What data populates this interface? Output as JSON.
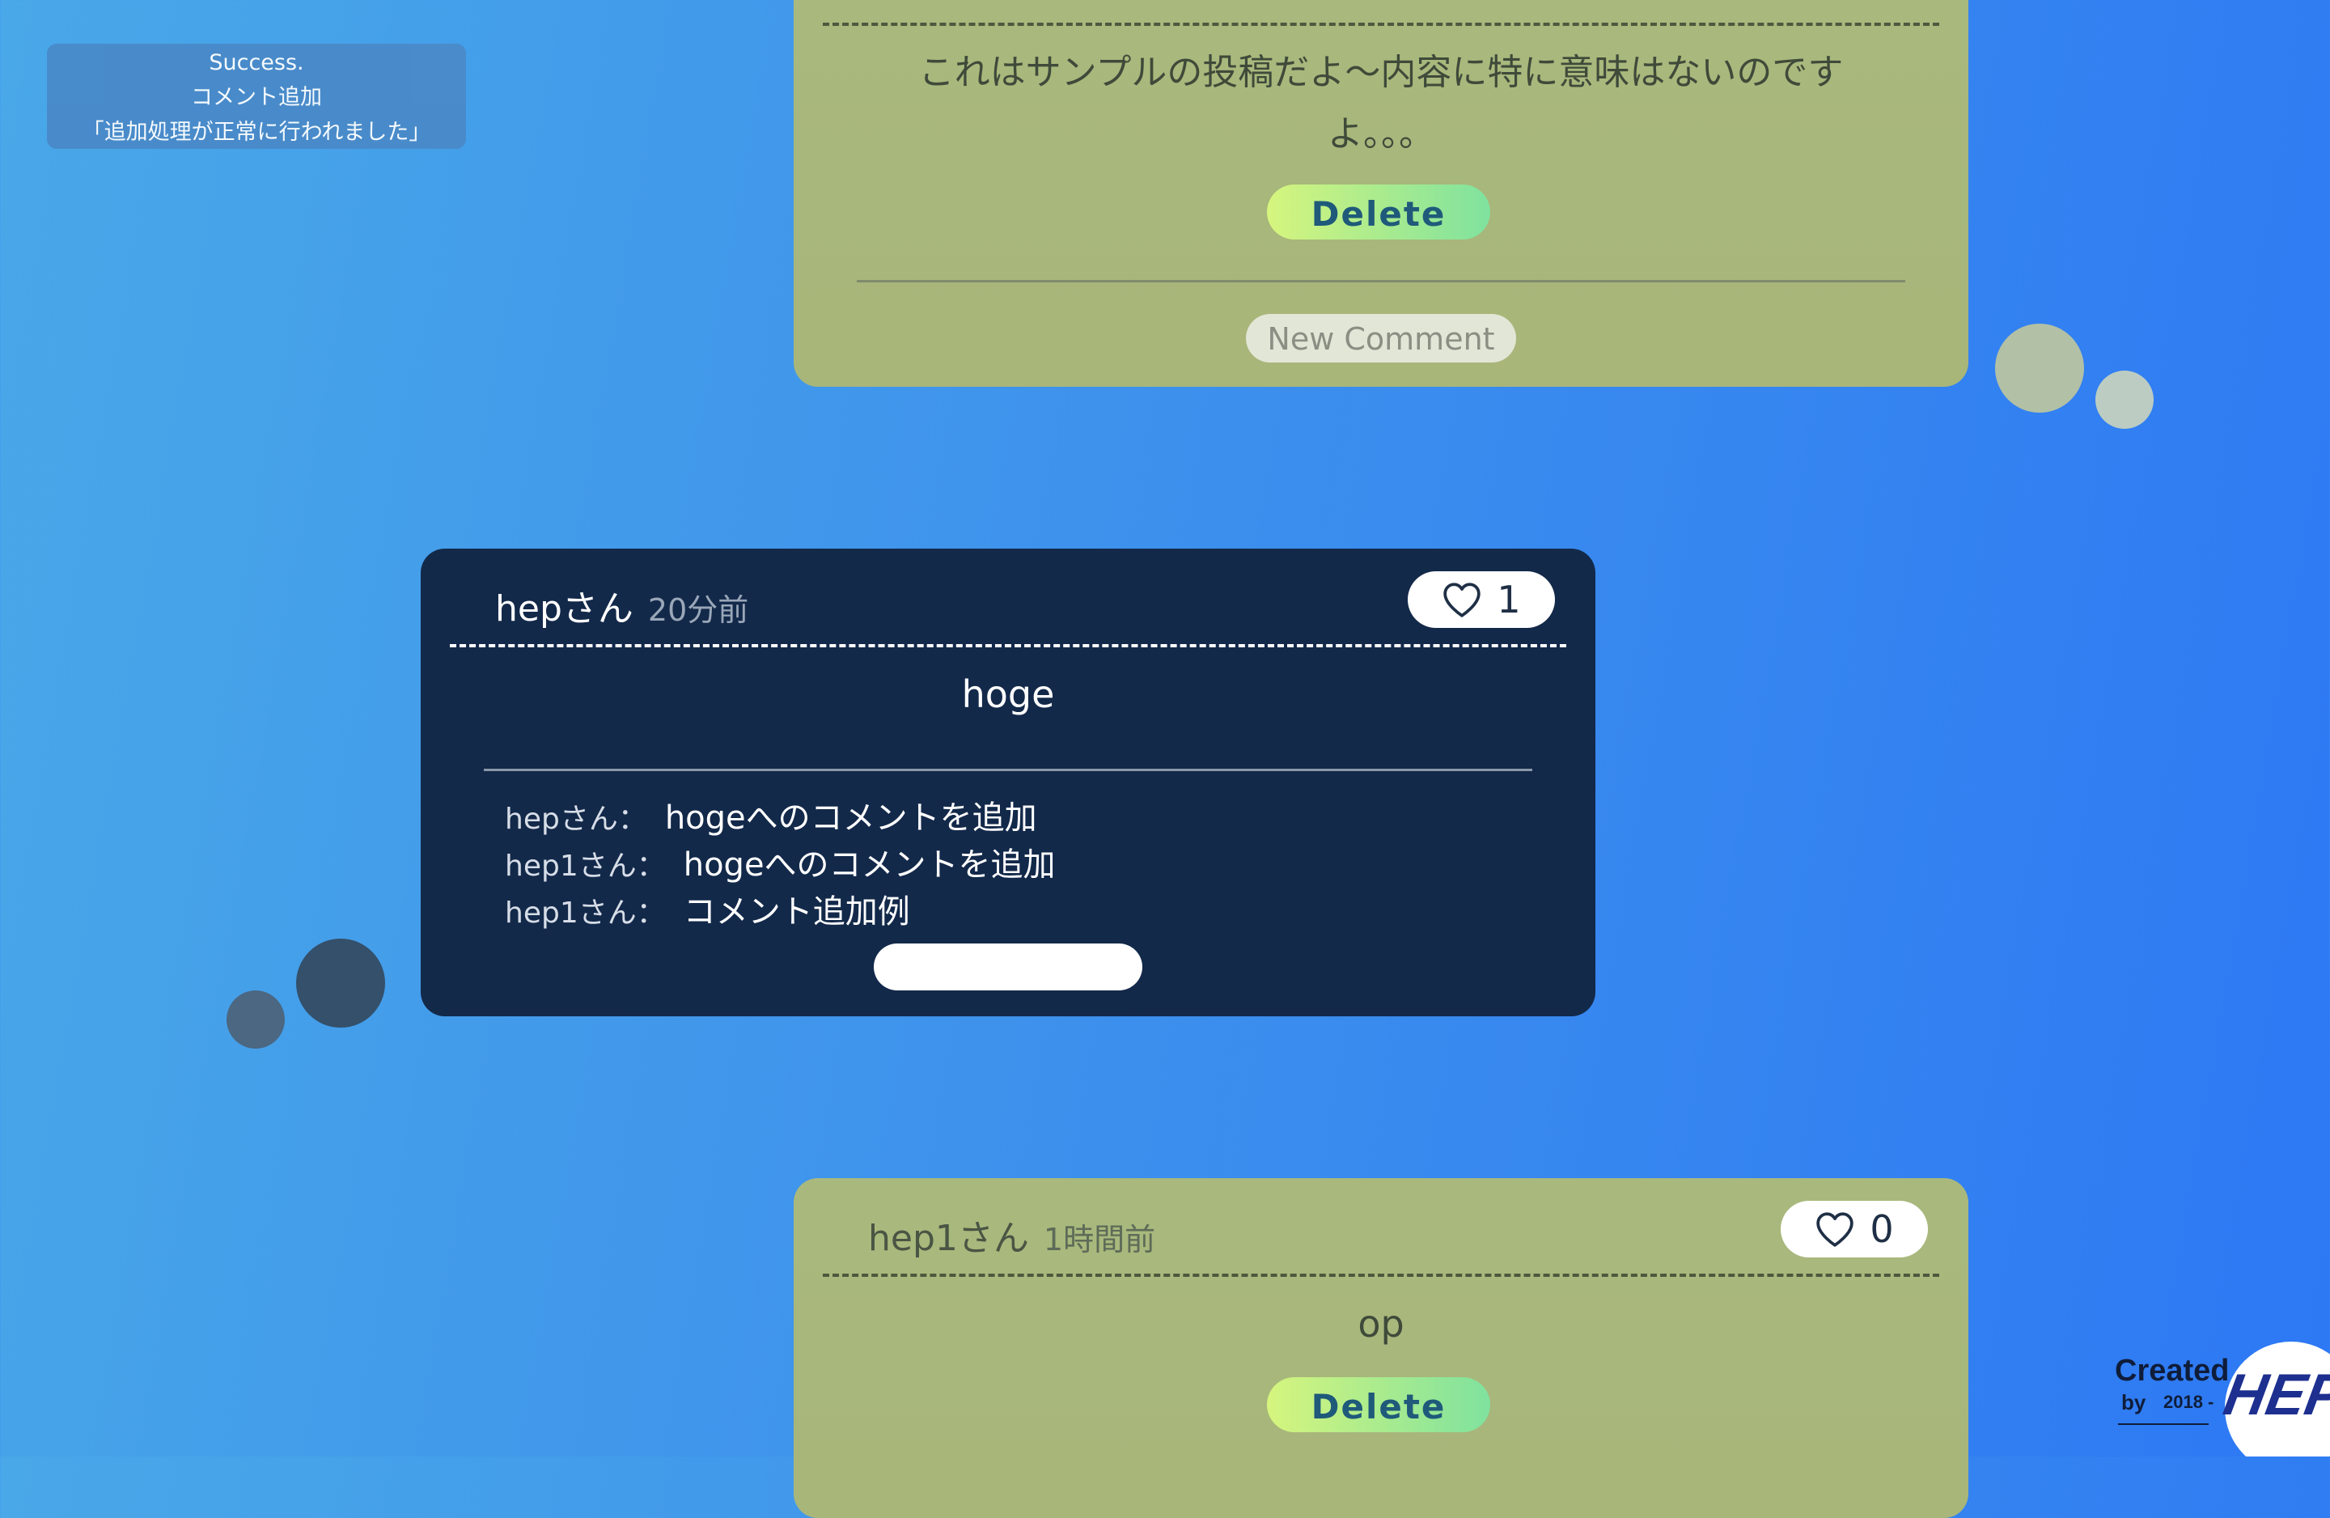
{
  "toast": {
    "line1": "Success.",
    "line2": "コメント追加",
    "line3": "「追加処理が正常に行われました」"
  },
  "posts": [
    {
      "body": "これはサンプルの投稿だよ〜内容に特に意味はないのですよ。。。",
      "delete_label": "Delete",
      "new_comment_label": "New Comment"
    },
    {
      "author": "hepさん",
      "time": "20分前",
      "likes": "1",
      "body": "hoge",
      "comments": [
        {
          "name": "hepさん：",
          "text": "hogeへのコメントを追加"
        },
        {
          "name": "hep1さん：",
          "text": "hogeへのコメントを追加"
        },
        {
          "name": "hep1さん：",
          "text": "コメント追加例"
        }
      ]
    },
    {
      "author": "hep1さん",
      "time": "1時間前",
      "likes": "0",
      "body": "op",
      "delete_label": "Delete"
    }
  ],
  "logo": {
    "created": "Created",
    "by": "by",
    "year": "2018 -",
    "brand": "HEP!"
  },
  "colors": {
    "olive_card": "#a9b87d",
    "dark_card": "#13294a",
    "delete_gradient_start": "#d6f57e",
    "delete_gradient_end": "#7fe29e"
  }
}
